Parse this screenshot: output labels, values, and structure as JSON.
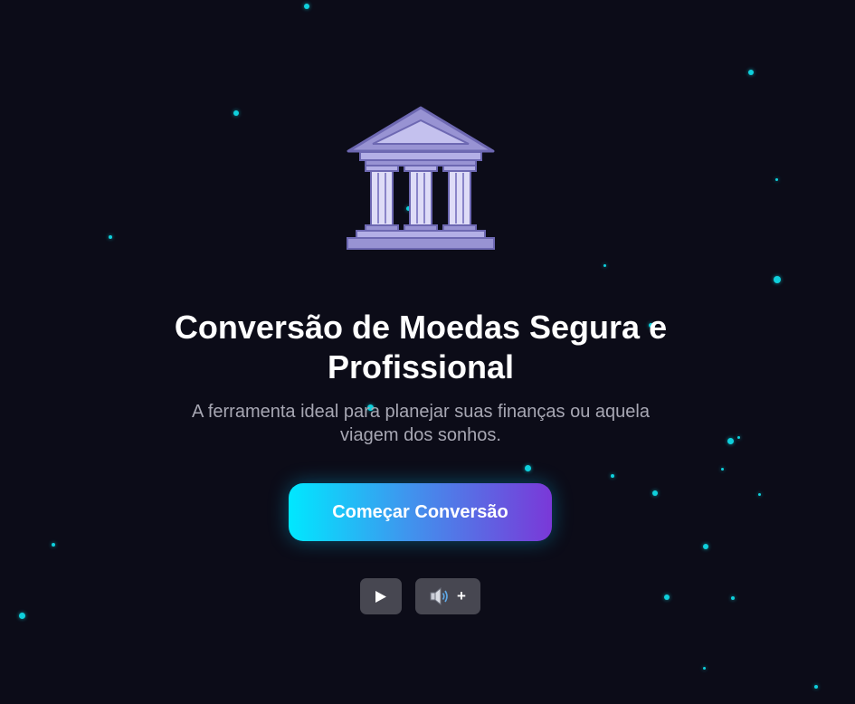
{
  "hero": {
    "title": "Conversão de Moedas Segura e Profissional",
    "subtitle": "A ferramenta ideal para planejar suas finanças ou aquela viagem dos sonhos.",
    "cta_label": "Começar Conversão",
    "logo_icon": "bank-building-icon"
  },
  "controls": {
    "play_icon": "play-icon",
    "sound_icon": "speaker-icon",
    "sound_plus": "+"
  },
  "colors": {
    "background": "#0c0c18",
    "particle": "#0fd0dc",
    "cta_gradient_start": "#00e8ff",
    "cta_gradient_end": "#7a38d8",
    "logo_fill": "#9b96d6",
    "control_bg": "#474751"
  }
}
